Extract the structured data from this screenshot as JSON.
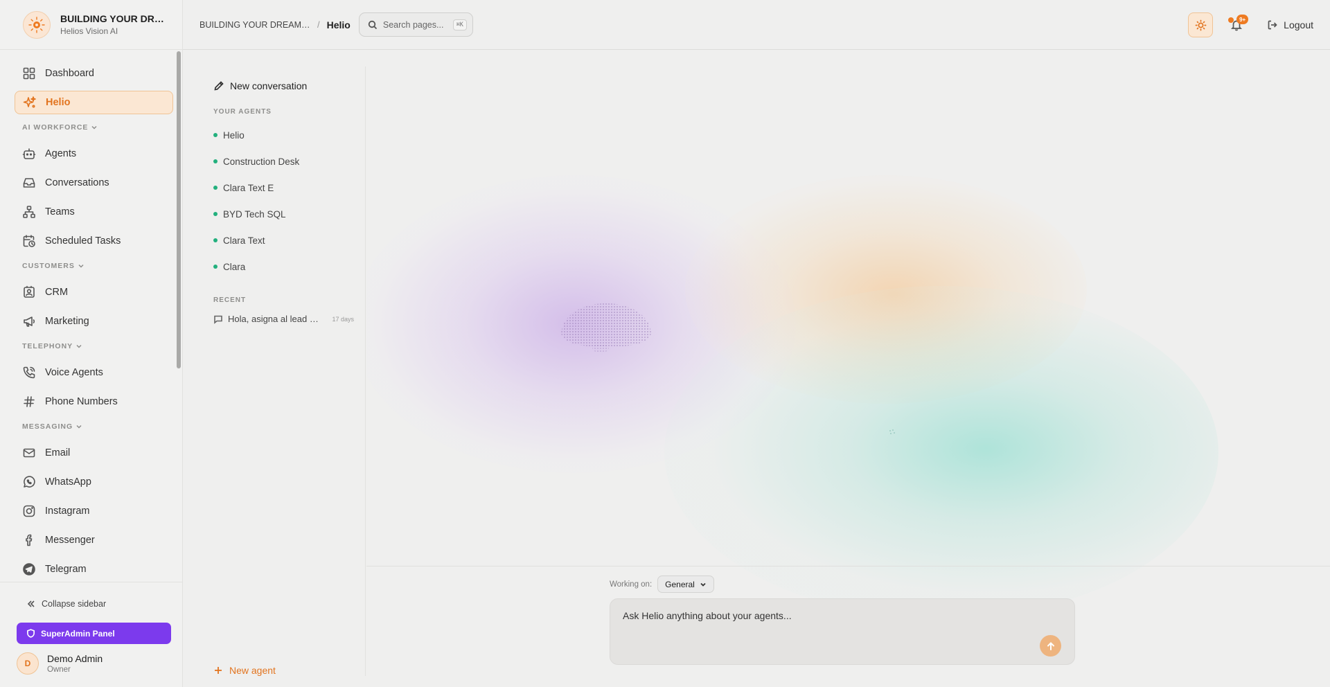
{
  "brand": {
    "name": "BUILDING YOUR DREAMS TOGETHER",
    "subtitle": "Helios Vision AI"
  },
  "sidebar": {
    "primary": [
      {
        "label": "Dashboard",
        "icon": "grid-icon"
      },
      {
        "label": "Helio",
        "icon": "sparkle-icon",
        "active": true
      }
    ],
    "sections": [
      {
        "title": "AI WORKFORCE",
        "items": [
          {
            "label": "Agents",
            "icon": "bot-icon"
          },
          {
            "label": "Conversations",
            "icon": "inbox-icon"
          },
          {
            "label": "Teams",
            "icon": "org-chart-icon"
          },
          {
            "label": "Scheduled Tasks",
            "icon": "calendar-clock-icon"
          }
        ]
      },
      {
        "title": "CUSTOMERS",
        "items": [
          {
            "label": "CRM",
            "icon": "contact-card-icon"
          },
          {
            "label": "Marketing",
            "icon": "megaphone-icon"
          }
        ]
      },
      {
        "title": "TELEPHONY",
        "items": [
          {
            "label": "Voice Agents",
            "icon": "phone-call-icon"
          },
          {
            "label": "Phone Numbers",
            "icon": "hash-icon"
          }
        ]
      },
      {
        "title": "MESSAGING",
        "items": [
          {
            "label": "Email",
            "icon": "mail-icon"
          },
          {
            "label": "WhatsApp",
            "icon": "whatsapp-icon"
          },
          {
            "label": "Instagram",
            "icon": "instagram-icon"
          },
          {
            "label": "Messenger",
            "icon": "facebook-icon"
          },
          {
            "label": "Telegram",
            "icon": "telegram-icon"
          }
        ]
      }
    ],
    "collapse_label": "Collapse sidebar",
    "superadmin_label": "SuperAdmin Panel",
    "user": {
      "initial": "D",
      "name": "Demo Admin",
      "role": "Owner"
    }
  },
  "header": {
    "breadcrumb_parent": "BUILDING YOUR DREAMS TOGETHER",
    "breadcrumb_separator": "/",
    "breadcrumb_current": "Helio",
    "search_placeholder": "Search pages...",
    "search_shortcut": "⌘K",
    "notification_count": "9+",
    "logout_label": "Logout"
  },
  "agent_panel": {
    "new_conversation_label": "New conversation",
    "agents_section_title": "YOUR AGENTS",
    "agents": [
      "Helio",
      "Construction Desk",
      "Clara Text E",
      "BYD Tech SQL",
      "Clara Text",
      "Clara"
    ],
    "recent_section_title": "RECENT",
    "recent": [
      {
        "title": "Hola, asigna al lead a la agente",
        "time": "17 days"
      }
    ],
    "new_agent_label": "New agent"
  },
  "composer": {
    "working_on_label": "Working on:",
    "context_value": "General",
    "placeholder": "Ask Helio anything about your agents..."
  },
  "colors": {
    "accent": "#e2741f",
    "superadmin": "#7c3aed",
    "agent_status": "#22b07d"
  }
}
